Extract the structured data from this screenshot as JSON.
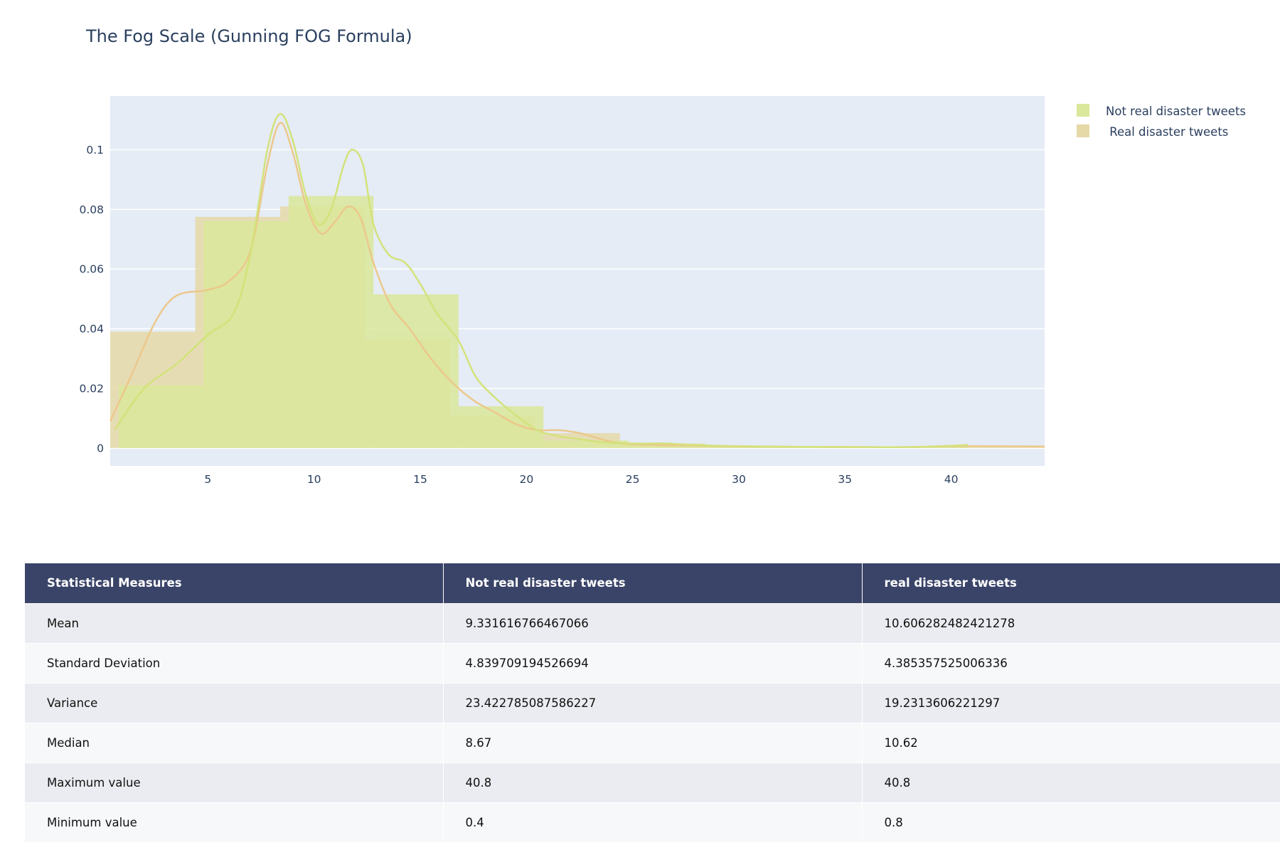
{
  "chart_data": {
    "type": "bar",
    "title": "The Fog Scale (Gunning FOG Formula)",
    "xlabel": "",
    "ylabel": "",
    "xlim": [
      0.4,
      44.4
    ],
    "ylim": [
      -0.006,
      0.118
    ],
    "x_ticks": [
      5,
      10,
      15,
      20,
      25,
      30,
      35,
      40
    ],
    "y_ticks": [
      0,
      0.02,
      0.04,
      0.06,
      0.08,
      0.1
    ],
    "y_tick_labels": [
      "0",
      "0.02",
      "0.04",
      "0.06",
      "0.08",
      "0.1"
    ],
    "grid": true,
    "legend_position": "top-right",
    "histograms": [
      {
        "name": "Real disaster tweets",
        "color": "#e6d9a8",
        "bins": [
          {
            "x0": 0.4,
            "x1": 4.4,
            "y": 0.039
          },
          {
            "x0": 4.4,
            "x1": 8.4,
            "y": 0.0775
          },
          {
            "x0": 8.4,
            "x1": 12.4,
            "y": 0.081
          },
          {
            "x0": 12.4,
            "x1": 16.4,
            "y": 0.0365
          },
          {
            "x0": 16.4,
            "x1": 20.4,
            "y": 0.011
          },
          {
            "x0": 20.4,
            "x1": 24.4,
            "y": 0.005
          },
          {
            "x0": 24.4,
            "x1": 28.4,
            "y": 0.0015
          },
          {
            "x0": 28.4,
            "x1": 32.4,
            "y": 0.0005
          },
          {
            "x0": 32.4,
            "x1": 36.4,
            "y": 0.0003
          },
          {
            "x0": 36.4,
            "x1": 40.4,
            "y": 0.0003
          },
          {
            "x0": 40.4,
            "x1": 44.4,
            "y": 0.0006
          }
        ]
      },
      {
        "name": "Not real disaster tweets",
        "color": "#d9e89a",
        "bins": [
          {
            "x0": 0.8,
            "x1": 4.8,
            "y": 0.021
          },
          {
            "x0": 4.8,
            "x1": 8.8,
            "y": 0.076
          },
          {
            "x0": 8.8,
            "x1": 12.8,
            "y": 0.0845
          },
          {
            "x0": 12.8,
            "x1": 16.8,
            "y": 0.0515
          },
          {
            "x0": 16.8,
            "x1": 20.8,
            "y": 0.014
          },
          {
            "x0": 20.8,
            "x1": 24.8,
            "y": 0.0025
          },
          {
            "x0": 24.8,
            "x1": 28.8,
            "y": 0.001
          },
          {
            "x0": 28.8,
            "x1": 32.8,
            "y": 0.0005
          },
          {
            "x0": 32.8,
            "x1": 36.8,
            "y": 0.0003
          },
          {
            "x0": 36.8,
            "x1": 40.8,
            "y": 0.0003
          }
        ]
      }
    ],
    "kde_curves": [
      {
        "name": "Real disaster tweets",
        "color": "#ecc88c",
        "points": [
          [
            0.4,
            0.009
          ],
          [
            1.5,
            0.026
          ],
          [
            2.5,
            0.042
          ],
          [
            3.5,
            0.051
          ],
          [
            5,
            0.053
          ],
          [
            6,
            0.056
          ],
          [
            7,
            0.066
          ],
          [
            7.8,
            0.095
          ],
          [
            8.4,
            0.109
          ],
          [
            9,
            0.099
          ],
          [
            9.6,
            0.082
          ],
          [
            10.3,
            0.072
          ],
          [
            11,
            0.076
          ],
          [
            11.6,
            0.081
          ],
          [
            12.2,
            0.077
          ],
          [
            12.8,
            0.062
          ],
          [
            13.6,
            0.048
          ],
          [
            14.5,
            0.04
          ],
          [
            15.5,
            0.03
          ],
          [
            16.5,
            0.022
          ],
          [
            17.5,
            0.016
          ],
          [
            18.5,
            0.012
          ],
          [
            19.5,
            0.008
          ],
          [
            20.5,
            0.006
          ],
          [
            21.5,
            0.006
          ],
          [
            22.5,
            0.005
          ],
          [
            23.5,
            0.003
          ],
          [
            24.5,
            0.0015
          ],
          [
            26,
            0.001
          ],
          [
            28,
            0.0008
          ],
          [
            30,
            0.0005
          ],
          [
            33,
            0.0004
          ],
          [
            36,
            0.0003
          ],
          [
            38,
            0.0003
          ],
          [
            40.4,
            0.0006
          ],
          [
            44.4,
            0.0005
          ]
        ]
      },
      {
        "name": "Not real disaster tweets",
        "color": "#d3e27a",
        "points": [
          [
            0.6,
            0.006
          ],
          [
            2,
            0.02
          ],
          [
            3.5,
            0.028
          ],
          [
            5,
            0.038
          ],
          [
            6.2,
            0.045
          ],
          [
            7,
            0.065
          ],
          [
            7.8,
            0.1
          ],
          [
            8.4,
            0.112
          ],
          [
            9,
            0.103
          ],
          [
            9.6,
            0.085
          ],
          [
            10.2,
            0.075
          ],
          [
            10.8,
            0.08
          ],
          [
            11.4,
            0.095
          ],
          [
            11.8,
            0.1
          ],
          [
            12.3,
            0.095
          ],
          [
            12.8,
            0.075
          ],
          [
            13.5,
            0.065
          ],
          [
            14.3,
            0.062
          ],
          [
            15,
            0.055
          ],
          [
            15.8,
            0.045
          ],
          [
            16.8,
            0.036
          ],
          [
            17.6,
            0.024
          ],
          [
            18.5,
            0.017
          ],
          [
            19.5,
            0.011
          ],
          [
            20.5,
            0.006
          ],
          [
            21.5,
            0.004
          ],
          [
            22.5,
            0.003
          ],
          [
            23.5,
            0.002
          ],
          [
            25,
            0.0015
          ],
          [
            26.5,
            0.0015
          ],
          [
            28,
            0.001
          ],
          [
            30,
            0.0006
          ],
          [
            33,
            0.0004
          ],
          [
            36,
            0.0003
          ],
          [
            38,
            0.0003
          ],
          [
            39.5,
            0.0006
          ],
          [
            40.8,
            0.001
          ]
        ]
      }
    ],
    "legend": [
      {
        "label": "Not real disaster tweets",
        "color": "#d9e89a"
      },
      {
        "label": " Real disaster tweets",
        "color": "#e6d9a8"
      }
    ]
  },
  "table": {
    "headers": [
      "Statistical Measures",
      "Not real disaster tweets",
      "real disaster tweets"
    ],
    "rows": [
      [
        "Mean",
        "9.331616766467066",
        "10.606282482421278"
      ],
      [
        "Standard Deviation",
        "4.839709194526694",
        "4.385357525006336"
      ],
      [
        "Variance",
        "23.422785087586227",
        "19.2313606221297"
      ],
      [
        "Median",
        "8.67",
        "10.62"
      ],
      [
        "Maximum value",
        "40.8",
        "40.8"
      ],
      [
        "Minimum value",
        "0.4",
        "0.8"
      ]
    ]
  }
}
